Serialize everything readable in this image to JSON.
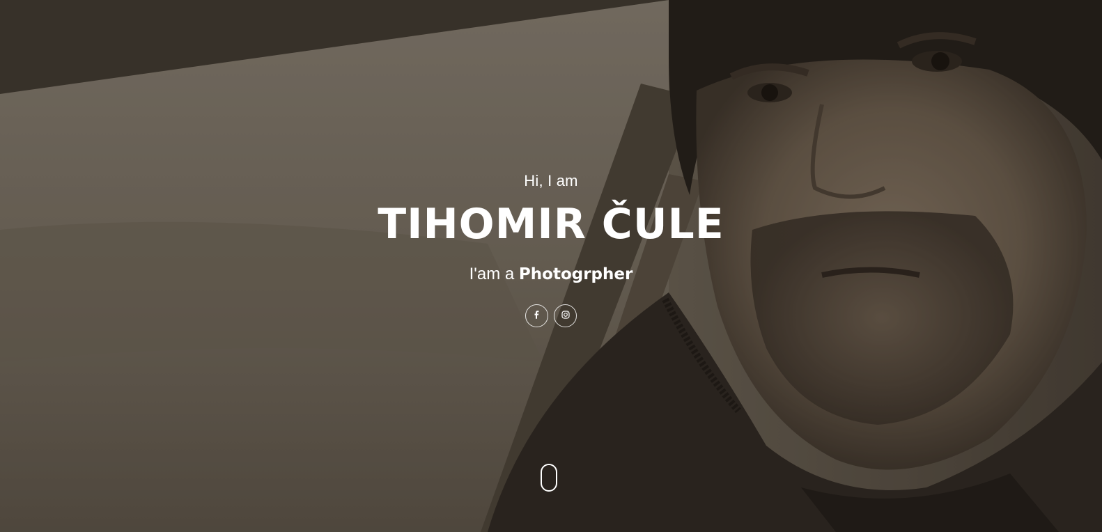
{
  "hero": {
    "greeting": "Hi, I am",
    "name": "TIHOMIR ČULE",
    "tagline_prefix": "I'am a",
    "tagline_role": "Photogrpher"
  },
  "socials": [
    {
      "icon": "facebook-icon"
    },
    {
      "icon": "instagram-icon"
    }
  ],
  "colors": {
    "text": "#ffffff",
    "overlay": "#2b2620"
  }
}
